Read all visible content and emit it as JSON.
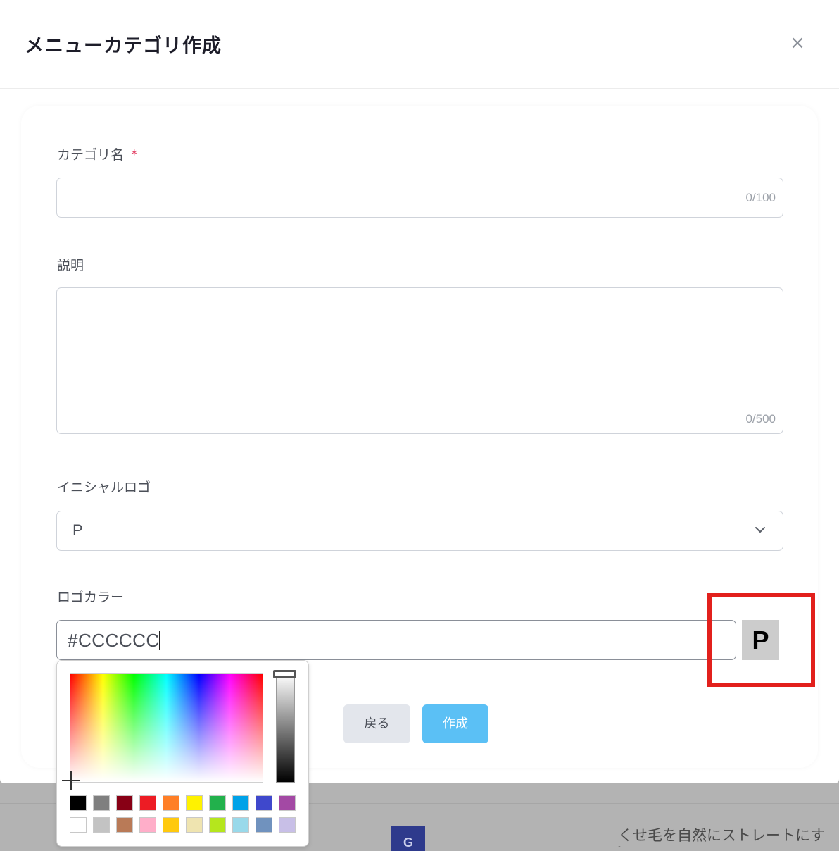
{
  "modal": {
    "title": "メニューカテゴリ作成",
    "close_label": "×"
  },
  "form": {
    "category_name": {
      "label": "カテゴリ名",
      "required_mark": "*",
      "value": "",
      "counter": "0/100"
    },
    "description": {
      "label": "説明",
      "value": "",
      "counter": "0/500"
    },
    "initial_logo": {
      "label": "イニシャルロゴ",
      "selected": "P"
    },
    "logo_color": {
      "label": "ロゴカラー",
      "value": "#CCCCCC",
      "preview_letter": "P",
      "preview_color": "#cccccc"
    },
    "back_button": "戻る",
    "create_button": "作成"
  },
  "color_picker": {
    "swatches_row1": [
      "#000000",
      "#7f7f7f",
      "#880015",
      "#ed1c24",
      "#ff7f27",
      "#fff200",
      "#22b14c",
      "#00a2e8",
      "#3f48cc",
      "#a349a4"
    ],
    "swatches_row2": [
      "#ffffff",
      "#c3c3c3",
      "#b97a57",
      "#ffaec9",
      "#ffc90e",
      "#efe4b0",
      "#b5e61d",
      "#99d9ea",
      "#7092be",
      "#c8bfe7"
    ]
  },
  "background": {
    "avatar_letter": "G",
    "text": "くせ毛を自然にストレートにす",
    "text2": "″"
  },
  "colors": {
    "primary_button": "#5bc0f5",
    "highlight_border": "#e2201c",
    "required": "#e2385d"
  }
}
